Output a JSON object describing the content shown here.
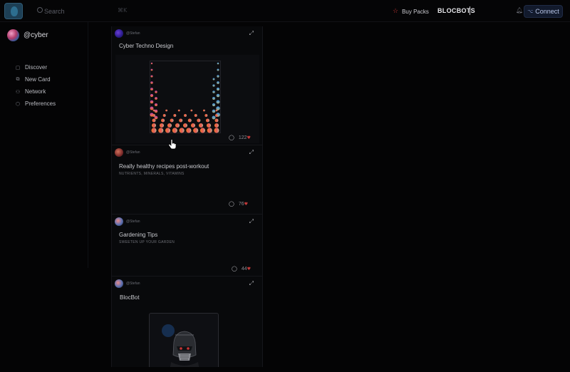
{
  "topbar": {
    "search_placeholder": "Search",
    "search_shortcut": "⌘K",
    "buy_packs": "Buy Packs",
    "brand": "BLOCBOTS",
    "connect": "Connect"
  },
  "sidebar": {
    "handle": "@cyber",
    "items": [
      {
        "icon": "book-icon",
        "label": "Discover"
      },
      {
        "icon": "cards-icon",
        "label": "New Card"
      },
      {
        "icon": "network-icon",
        "label": "Network"
      },
      {
        "icon": "shield-icon",
        "label": "Preferences"
      }
    ]
  },
  "feed": {
    "cards": [
      {
        "user": "@Stefan",
        "title": "Cyber Techno Design",
        "comments": "122"
      },
      {
        "user": "@Stefan",
        "title": "Really healthy recipes post-workout",
        "subtitle": "NUTRIENTS, MINERALS, VITAMINS",
        "comments": "76"
      },
      {
        "user": "@Stefan",
        "title": "Gardening Tips",
        "subtitle": "SWEETEN UP YOUR GARDEN",
        "comments": "44"
      },
      {
        "user": "@Stefan",
        "title": "BlocBot"
      }
    ]
  },
  "colors": {
    "background": "#040405",
    "accent_heart": "#c63a3a",
    "connect_bg": "#121a2c"
  }
}
